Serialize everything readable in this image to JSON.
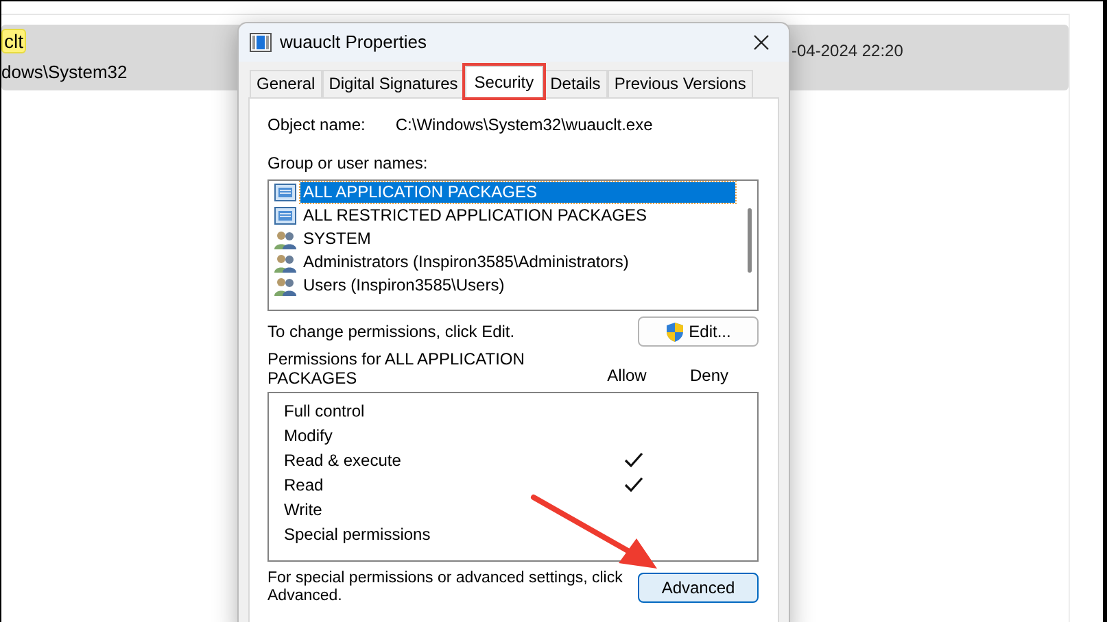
{
  "background": {
    "result_name": "clt",
    "result_path": "dows\\System32",
    "result_date": "-04-2024 22:20"
  },
  "dialog": {
    "title": "wuauclt Properties",
    "tabs": [
      {
        "label": "General",
        "selected": false,
        "highlighted": false
      },
      {
        "label": "Digital Signatures",
        "selected": false,
        "highlighted": false
      },
      {
        "label": "Security",
        "selected": true,
        "highlighted": true
      },
      {
        "label": "Details",
        "selected": false,
        "highlighted": false
      },
      {
        "label": "Previous Versions",
        "selected": false,
        "highlighted": false
      }
    ],
    "object_name_label": "Object name:",
    "object_name": "C:\\Windows\\System32\\wuauclt.exe",
    "groups_label": "Group or user names:",
    "groups": [
      {
        "name": "ALL APPLICATION PACKAGES",
        "kind": "package",
        "selected": true
      },
      {
        "name": "ALL RESTRICTED APPLICATION PACKAGES",
        "kind": "package",
        "selected": false
      },
      {
        "name": "SYSTEM",
        "kind": "users",
        "selected": false
      },
      {
        "name": "Administrators (Inspiron3585\\Administrators)",
        "kind": "users",
        "selected": false
      },
      {
        "name": "Users (Inspiron3585\\Users)",
        "kind": "users",
        "selected": false
      }
    ],
    "change_hint": "To change permissions, click Edit.",
    "edit_button": "Edit...",
    "permissions_label": "Permissions for ALL APPLICATION PACKAGES",
    "allow_header": "Allow",
    "deny_header": "Deny",
    "permissions": [
      {
        "name": "Full control",
        "allow": false,
        "deny": false
      },
      {
        "name": "Modify",
        "allow": false,
        "deny": false
      },
      {
        "name": "Read & execute",
        "allow": true,
        "deny": false
      },
      {
        "name": "Read",
        "allow": true,
        "deny": false
      },
      {
        "name": "Write",
        "allow": false,
        "deny": false
      },
      {
        "name": "Special permissions",
        "allow": false,
        "deny": false
      }
    ],
    "advanced_hint": "For special permissions or advanced settings, click Advanced.",
    "advanced_button": "Advanced"
  }
}
